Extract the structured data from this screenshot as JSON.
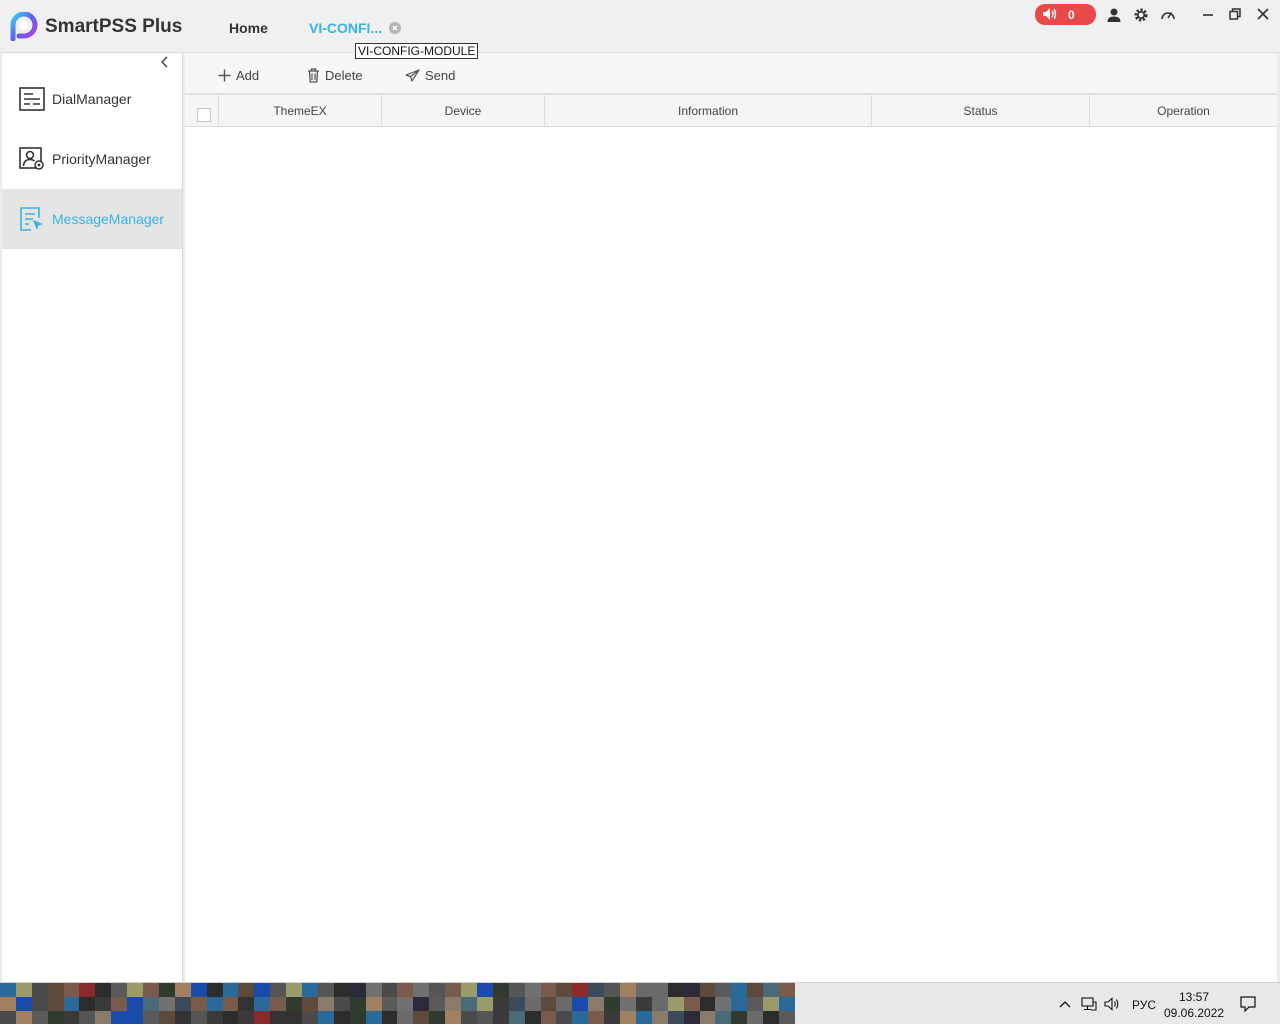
{
  "app": {
    "title": "SmartPSS Plus"
  },
  "tabs": [
    {
      "label": "Home"
    },
    {
      "label": "VI-CONFI..."
    }
  ],
  "tooltip": {
    "text": "VI-CONFIG-MODULE"
  },
  "header": {
    "alarm_count": "0"
  },
  "sidebar": {
    "items": [
      {
        "label": "DialManager"
      },
      {
        "label": "PriorityManager"
      },
      {
        "label": "MessageManager",
        "active": true
      }
    ]
  },
  "toolbar": {
    "add_label": "Add",
    "delete_label": "Delete",
    "send_label": "Send"
  },
  "table": {
    "columns": [
      "ThemeEX",
      "Device",
      "Information",
      "Status",
      "Operation"
    ],
    "rows": []
  },
  "taskbar": {
    "language": "РУС",
    "time": "13:57",
    "date": "09.06.2022"
  },
  "colors": {
    "accent": "#35b4e6",
    "alarm": "#e84a4a"
  }
}
